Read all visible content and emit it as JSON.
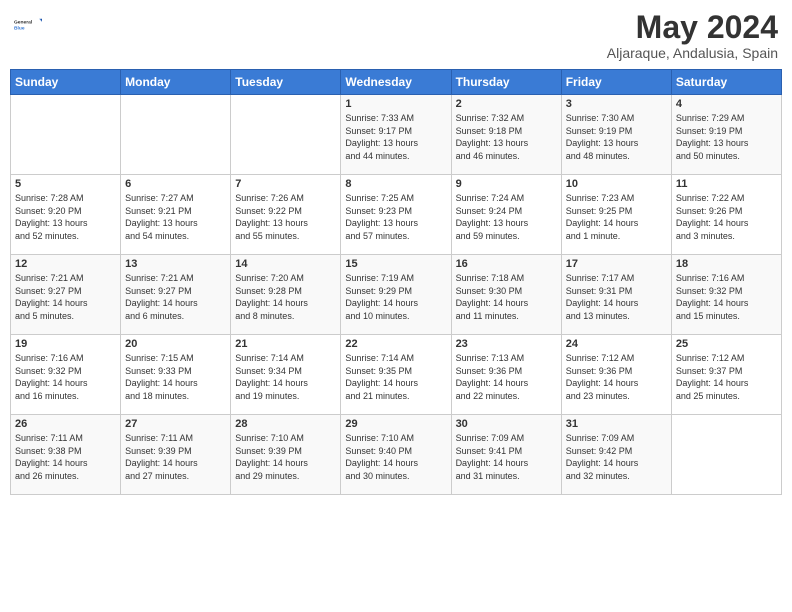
{
  "header": {
    "logo_general": "General",
    "logo_blue": "Blue",
    "month_year": "May 2024",
    "location": "Aljaraque, Andalusia, Spain"
  },
  "days_of_week": [
    "Sunday",
    "Monday",
    "Tuesday",
    "Wednesday",
    "Thursday",
    "Friday",
    "Saturday"
  ],
  "weeks": [
    [
      {
        "day": "",
        "info": ""
      },
      {
        "day": "",
        "info": ""
      },
      {
        "day": "",
        "info": ""
      },
      {
        "day": "1",
        "info": "Sunrise: 7:33 AM\nSunset: 9:17 PM\nDaylight: 13 hours\nand 44 minutes."
      },
      {
        "day": "2",
        "info": "Sunrise: 7:32 AM\nSunset: 9:18 PM\nDaylight: 13 hours\nand 46 minutes."
      },
      {
        "day": "3",
        "info": "Sunrise: 7:30 AM\nSunset: 9:19 PM\nDaylight: 13 hours\nand 48 minutes."
      },
      {
        "day": "4",
        "info": "Sunrise: 7:29 AM\nSunset: 9:19 PM\nDaylight: 13 hours\nand 50 minutes."
      }
    ],
    [
      {
        "day": "5",
        "info": "Sunrise: 7:28 AM\nSunset: 9:20 PM\nDaylight: 13 hours\nand 52 minutes."
      },
      {
        "day": "6",
        "info": "Sunrise: 7:27 AM\nSunset: 9:21 PM\nDaylight: 13 hours\nand 54 minutes."
      },
      {
        "day": "7",
        "info": "Sunrise: 7:26 AM\nSunset: 9:22 PM\nDaylight: 13 hours\nand 55 minutes."
      },
      {
        "day": "8",
        "info": "Sunrise: 7:25 AM\nSunset: 9:23 PM\nDaylight: 13 hours\nand 57 minutes."
      },
      {
        "day": "9",
        "info": "Sunrise: 7:24 AM\nSunset: 9:24 PM\nDaylight: 13 hours\nand 59 minutes."
      },
      {
        "day": "10",
        "info": "Sunrise: 7:23 AM\nSunset: 9:25 PM\nDaylight: 14 hours\nand 1 minute."
      },
      {
        "day": "11",
        "info": "Sunrise: 7:22 AM\nSunset: 9:26 PM\nDaylight: 14 hours\nand 3 minutes."
      }
    ],
    [
      {
        "day": "12",
        "info": "Sunrise: 7:21 AM\nSunset: 9:27 PM\nDaylight: 14 hours\nand 5 minutes."
      },
      {
        "day": "13",
        "info": "Sunrise: 7:21 AM\nSunset: 9:27 PM\nDaylight: 14 hours\nand 6 minutes."
      },
      {
        "day": "14",
        "info": "Sunrise: 7:20 AM\nSunset: 9:28 PM\nDaylight: 14 hours\nand 8 minutes."
      },
      {
        "day": "15",
        "info": "Sunrise: 7:19 AM\nSunset: 9:29 PM\nDaylight: 14 hours\nand 10 minutes."
      },
      {
        "day": "16",
        "info": "Sunrise: 7:18 AM\nSunset: 9:30 PM\nDaylight: 14 hours\nand 11 minutes."
      },
      {
        "day": "17",
        "info": "Sunrise: 7:17 AM\nSunset: 9:31 PM\nDaylight: 14 hours\nand 13 minutes."
      },
      {
        "day": "18",
        "info": "Sunrise: 7:16 AM\nSunset: 9:32 PM\nDaylight: 14 hours\nand 15 minutes."
      }
    ],
    [
      {
        "day": "19",
        "info": "Sunrise: 7:16 AM\nSunset: 9:32 PM\nDaylight: 14 hours\nand 16 minutes."
      },
      {
        "day": "20",
        "info": "Sunrise: 7:15 AM\nSunset: 9:33 PM\nDaylight: 14 hours\nand 18 minutes."
      },
      {
        "day": "21",
        "info": "Sunrise: 7:14 AM\nSunset: 9:34 PM\nDaylight: 14 hours\nand 19 minutes."
      },
      {
        "day": "22",
        "info": "Sunrise: 7:14 AM\nSunset: 9:35 PM\nDaylight: 14 hours\nand 21 minutes."
      },
      {
        "day": "23",
        "info": "Sunrise: 7:13 AM\nSunset: 9:36 PM\nDaylight: 14 hours\nand 22 minutes."
      },
      {
        "day": "24",
        "info": "Sunrise: 7:12 AM\nSunset: 9:36 PM\nDaylight: 14 hours\nand 23 minutes."
      },
      {
        "day": "25",
        "info": "Sunrise: 7:12 AM\nSunset: 9:37 PM\nDaylight: 14 hours\nand 25 minutes."
      }
    ],
    [
      {
        "day": "26",
        "info": "Sunrise: 7:11 AM\nSunset: 9:38 PM\nDaylight: 14 hours\nand 26 minutes."
      },
      {
        "day": "27",
        "info": "Sunrise: 7:11 AM\nSunset: 9:39 PM\nDaylight: 14 hours\nand 27 minutes."
      },
      {
        "day": "28",
        "info": "Sunrise: 7:10 AM\nSunset: 9:39 PM\nDaylight: 14 hours\nand 29 minutes."
      },
      {
        "day": "29",
        "info": "Sunrise: 7:10 AM\nSunset: 9:40 PM\nDaylight: 14 hours\nand 30 minutes."
      },
      {
        "day": "30",
        "info": "Sunrise: 7:09 AM\nSunset: 9:41 PM\nDaylight: 14 hours\nand 31 minutes."
      },
      {
        "day": "31",
        "info": "Sunrise: 7:09 AM\nSunset: 9:42 PM\nDaylight: 14 hours\nand 32 minutes."
      },
      {
        "day": "",
        "info": ""
      }
    ]
  ]
}
